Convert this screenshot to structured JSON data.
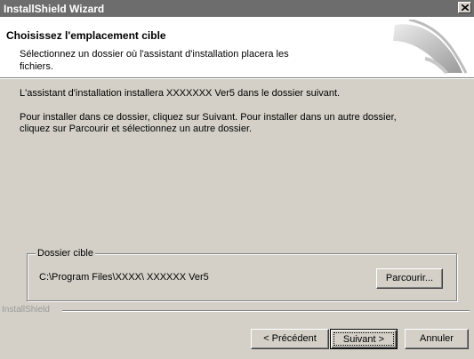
{
  "window": {
    "title": "InstallShield Wizard",
    "close_glyph": "×"
  },
  "header": {
    "title": "Choisissez l'emplacement cible",
    "subtitle": "Sélectionnez un dossier où l'assistant d'installation placera les fichiers."
  },
  "body": {
    "line1": "L'assistant d'installation installera XXXXXXX Ver5 dans le dossier suivant.",
    "line2a": "Pour installer dans ce dossier, cliquez sur Suivant. Pour installer dans un autre dossier,",
    "line2b": "cliquez sur Parcourir et sélectionnez un autre dossier."
  },
  "destination": {
    "group_label": "Dossier cible",
    "path": "C:\\Program Files\\XXXX\\ XXXXXX  Ver5",
    "browse_label": "Parcourir..."
  },
  "footer": {
    "brand": "InstallShield",
    "back_label": "< Précédent",
    "next_label": "Suivant >",
    "cancel_label": "Annuler"
  },
  "colors": {
    "title_bar": "#6d6d6d",
    "dialog_bg": "#d4d0c8",
    "header_bg": "#ffffff",
    "brand_text": "#9a9a9a"
  },
  "icons": [
    "close-icon",
    "installshield-graphic-icon"
  ]
}
